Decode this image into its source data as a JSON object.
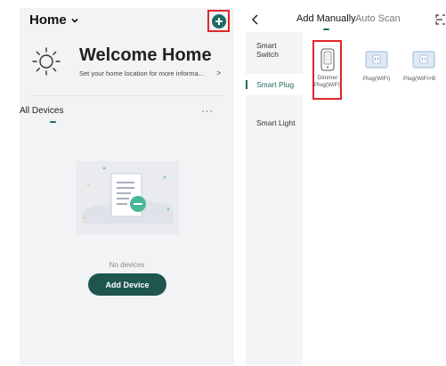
{
  "left": {
    "home_label": "Home",
    "welcome_title": "Welcome Home",
    "welcome_subtitle": "Set your home location for more informa...",
    "welcome_arrow": ">",
    "all_devices_label": "All Devices",
    "more_label": "···",
    "empty_text": "No devices",
    "add_device_label": "Add Device"
  },
  "right": {
    "back_label": "<",
    "tabs": [
      {
        "label": "Add Manually",
        "active": true
      },
      {
        "label": "Auto Scan",
        "active": false
      }
    ],
    "categories": [
      {
        "label": "Smart Switch",
        "active": false
      },
      {
        "label": "Smart Plug",
        "active": true
      },
      {
        "label": "Smart Light",
        "active": false
      }
    ],
    "devices": [
      {
        "label": "Dimmer Plug(WiFi)",
        "icon": "dimmer-plug-icon",
        "highlighted": true
      },
      {
        "label": "Plug(WiFi)",
        "icon": "plug-icon",
        "highlighted": false
      },
      {
        "label": "Plug(WiFi+B",
        "icon": "plug-icon",
        "highlighted": false
      }
    ]
  },
  "colors": {
    "accent": "#1d6b5e",
    "button": "#1e564f",
    "highlight": "#e0262d",
    "panel_bg": "#f2f3f5"
  }
}
